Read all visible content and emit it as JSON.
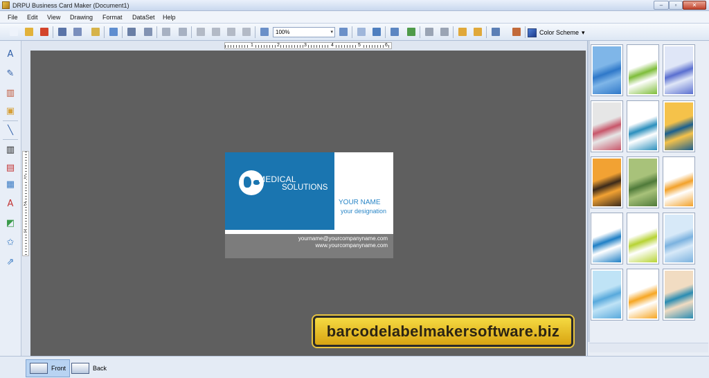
{
  "window": {
    "title": "DRPU Business Card Maker (Document1)",
    "minimize": "–",
    "restore": "▫",
    "close": "✕"
  },
  "menu": [
    "File",
    "Edit",
    "View",
    "Drawing",
    "Format",
    "DataSet",
    "Help"
  ],
  "toolbar": {
    "zoom_value": "100%",
    "color_scheme_label": "Color Scheme",
    "dropdown_arrow": "▾"
  },
  "ruler": {
    "h_numbers": [
      "1",
      "2",
      "3",
      "4",
      "5",
      "6"
    ],
    "v_numbers": [
      "1",
      "2",
      "3"
    ]
  },
  "card": {
    "company_line1": "MEDICAL",
    "company_line2": "SOLUTIONS",
    "name": "YOUR NAME",
    "designation": "your designation",
    "email": "yourname@yourcompanyname.com",
    "website": "www.yourcompanyname.com",
    "colors": {
      "blue": "#1a75b0",
      "gray": "#7c7c7c",
      "name_text": "#2a86c7"
    }
  },
  "watermark": "barcodelabelmakersoftware.biz",
  "templates": [
    {
      "a": "#7fb6e8",
      "b": "#2f78c9"
    },
    {
      "a": "#ffffff",
      "b": "#7ebd3a"
    },
    {
      "a": "#dfe6f7",
      "b": "#5a6fd0"
    },
    {
      "a": "#e6e6e6",
      "b": "#c8566a"
    },
    {
      "a": "#ffffff",
      "b": "#2b8fbd"
    },
    {
      "a": "#f5c24a",
      "b": "#1b5f8e"
    },
    {
      "a": "#f2a233",
      "b": "#3c2a1a"
    },
    {
      "a": "#a8c27a",
      "b": "#4f7a3a"
    },
    {
      "a": "#ffffff",
      "b": "#f2a12a"
    },
    {
      "a": "#ffffff",
      "b": "#1f7fc5"
    },
    {
      "a": "#ffffff",
      "b": "#b7d334"
    },
    {
      "a": "#d7e9f8",
      "b": "#7bb2df"
    },
    {
      "a": "#bfe3f6",
      "b": "#58a9dc"
    },
    {
      "a": "#ffffff",
      "b": "#f6a623"
    },
    {
      "a": "#f1dcc2",
      "b": "#2a8cb2"
    }
  ],
  "bottom_tabs": {
    "front": "Front",
    "back": "Back"
  }
}
